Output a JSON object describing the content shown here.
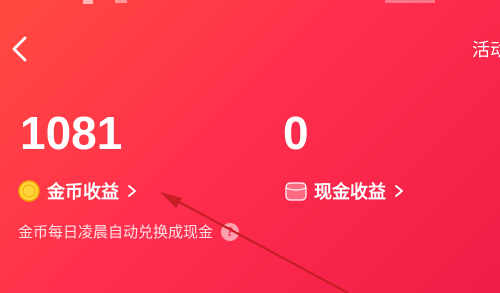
{
  "header": {
    "right_link": "活动"
  },
  "coins": {
    "value": "1081",
    "label": "金币收益"
  },
  "cash": {
    "value": "0",
    "label": "现金收益"
  },
  "hint": {
    "text": "金币每日凌晨自动兑换成现金",
    "help": "?"
  },
  "icons": {
    "back": "back-chevron-icon",
    "coin": "gold-coin-icon",
    "wallet": "wallet-icon",
    "chevron": "chevron-right-icon",
    "help": "question-icon"
  },
  "colors": {
    "bg_start": "#ff4a3e",
    "bg_end": "#f01c47",
    "coin": "#ffd33b",
    "wallet": "#ff5a72",
    "annotation": "#c81d25"
  }
}
